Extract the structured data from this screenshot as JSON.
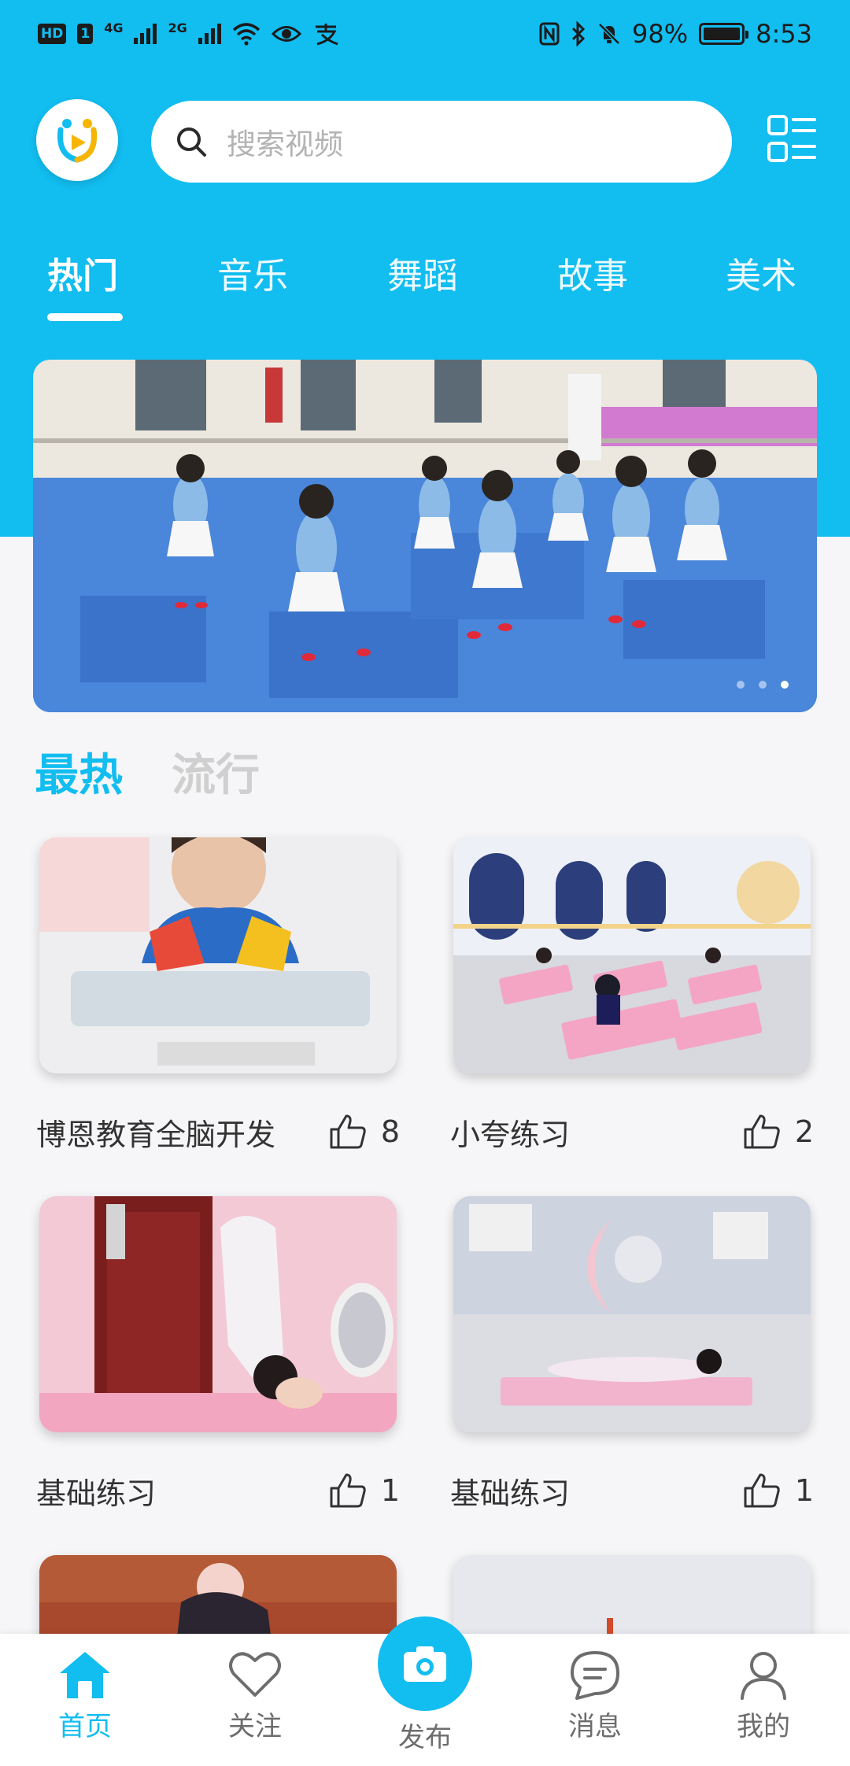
{
  "status_bar": {
    "left_chip_1": "HD",
    "left_chip_2": "1",
    "signal_1": "4G",
    "signal_2": "2G",
    "battery_text": "98%",
    "time": "8:53"
  },
  "header": {
    "search_placeholder": "搜索视频"
  },
  "tabs": [
    {
      "label": "热门"
    },
    {
      "label": "音乐"
    },
    {
      "label": "舞蹈"
    },
    {
      "label": "故事"
    },
    {
      "label": "美术"
    }
  ],
  "banner": {
    "slide_count": 3,
    "active_index": 2
  },
  "section_tabs": [
    {
      "label": "最热"
    },
    {
      "label": "流行"
    }
  ],
  "videos": [
    {
      "title": "博恩教育全脑开发",
      "likes": "8"
    },
    {
      "title": "小夸练习",
      "likes": "2"
    },
    {
      "title": "基础练习",
      "likes": "1"
    },
    {
      "title": "基础练习",
      "likes": "1"
    },
    {
      "title": "",
      "likes": ""
    },
    {
      "title": "",
      "likes": ""
    }
  ],
  "bottom_nav": [
    {
      "label": "首页"
    },
    {
      "label": "关注"
    },
    {
      "label": "发布"
    },
    {
      "label": "消息"
    },
    {
      "label": "我的"
    }
  ],
  "colors": {
    "accent": "#12bdf0",
    "background": "#f6f6f8"
  }
}
